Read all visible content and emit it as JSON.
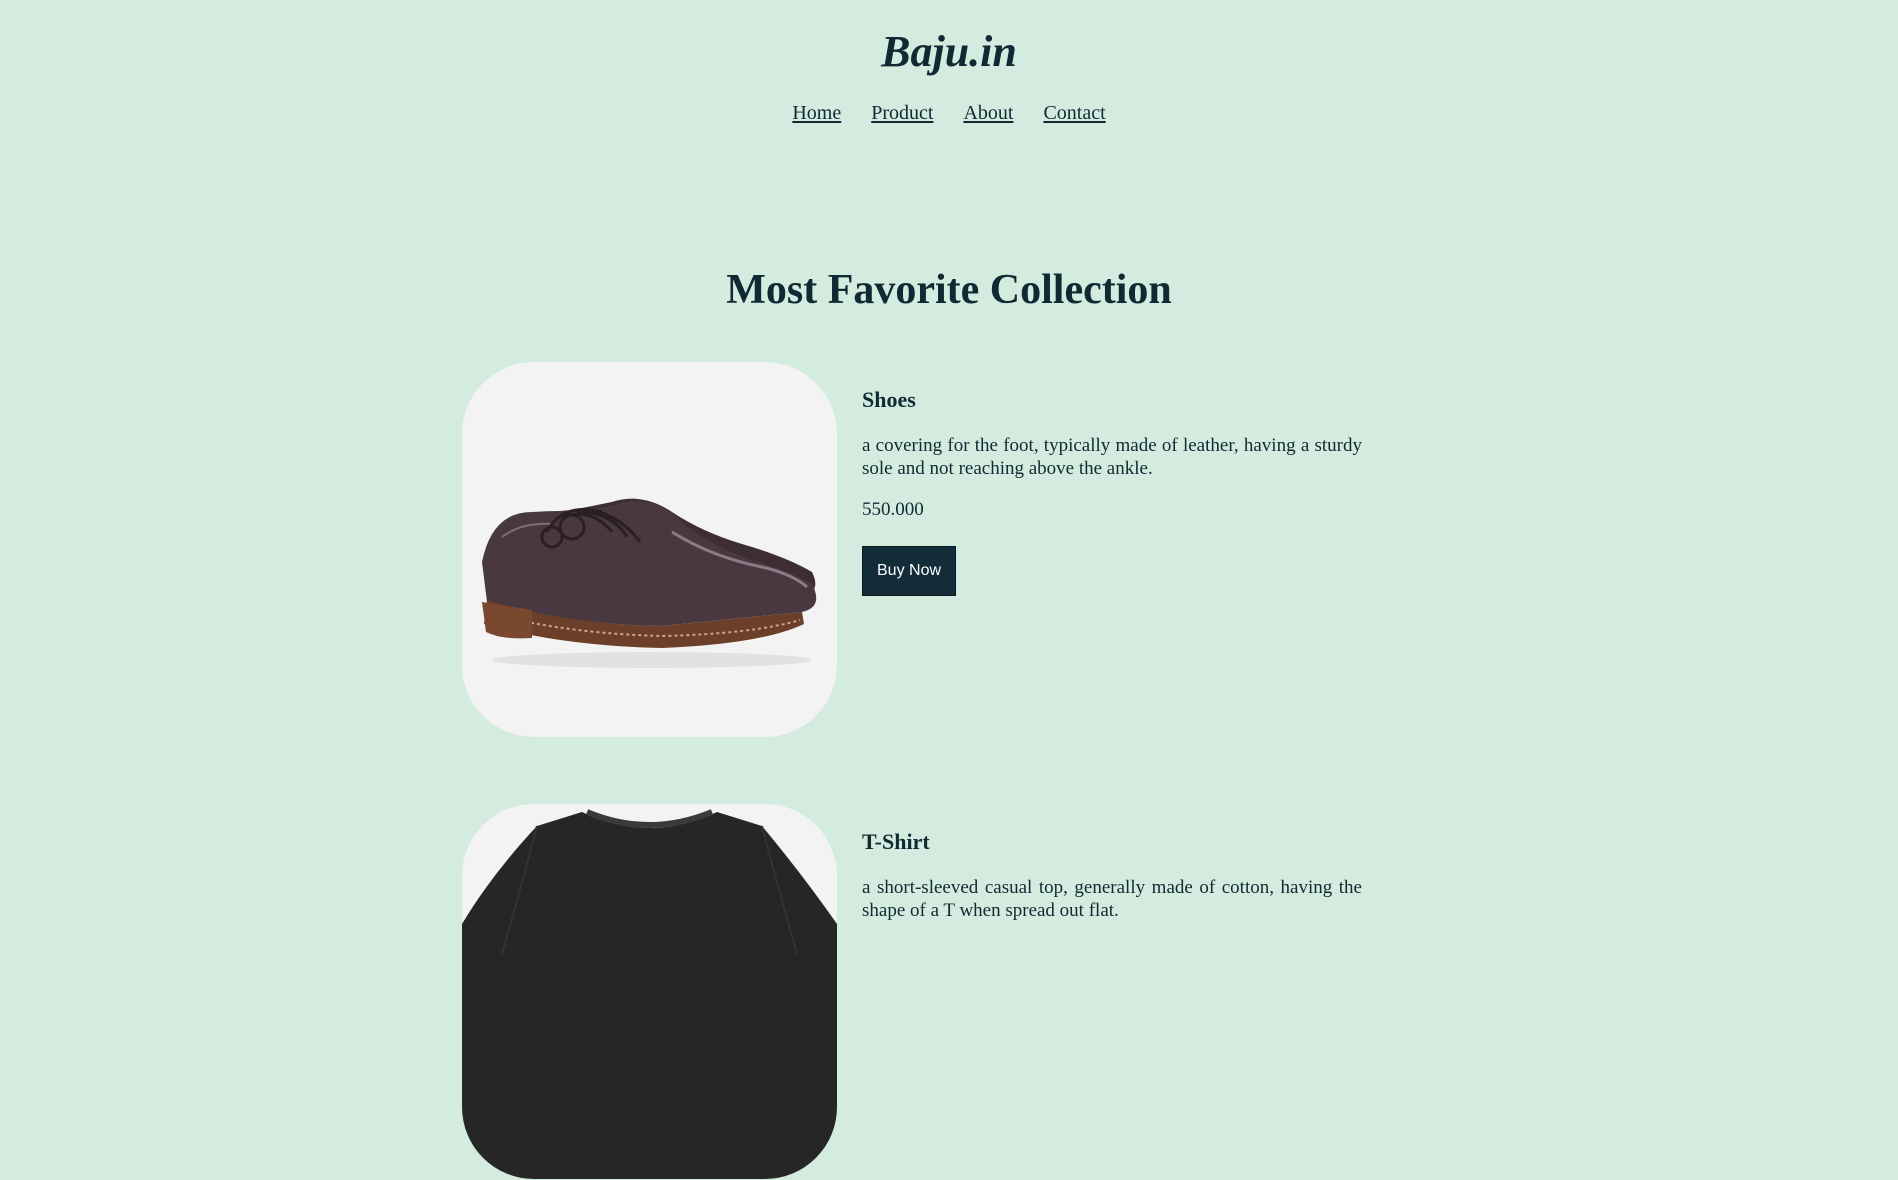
{
  "header": {
    "brand": "Baju.in",
    "nav": [
      "Home",
      "Product",
      "About",
      "Contact"
    ]
  },
  "section": {
    "title": "Most Favorite Collection"
  },
  "products": [
    {
      "name": "Shoes",
      "description": "a covering for the foot, typically made of leather, having a sturdy sole and not reaching above the ankle.",
      "price": "550.000",
      "button": "Buy Now",
      "image_icon": "leather-shoes-icon"
    },
    {
      "name": "T-Shirt",
      "description": "a short-sleeved casual top, generally made of cotton, having the shape of a T when spread out flat.",
      "price": "",
      "button": "",
      "image_icon": "tshirt-icon"
    }
  ],
  "colors": {
    "background": "#d4ecdf",
    "text": "#0f2a33",
    "button_bg": "#132d38",
    "card_bg": "#f3f3f3"
  }
}
